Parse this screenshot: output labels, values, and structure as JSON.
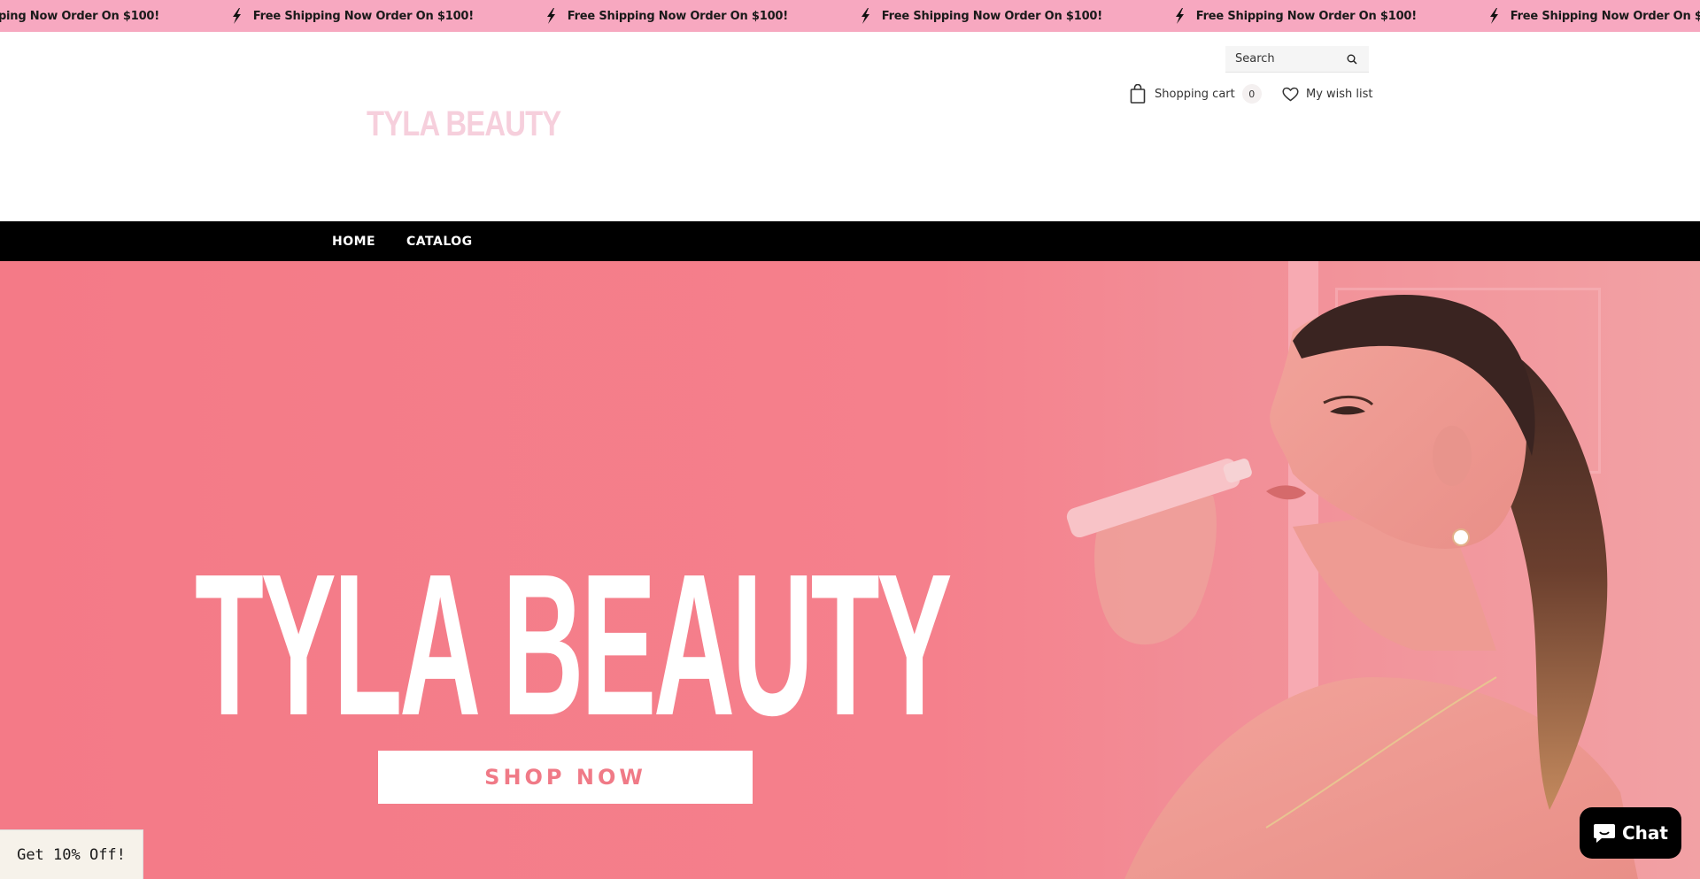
{
  "announcement": {
    "message": "Free Shipping Now Order On $100!",
    "partial_message": "ping Now Order On $100!",
    "icon": "lightning-bolt-icon",
    "background": "#f7a8c0"
  },
  "header": {
    "logo_text": "TYLA BEAUTY",
    "search": {
      "placeholder": "Search",
      "icon": "search-icon"
    },
    "cart": {
      "label": "Shopping cart",
      "count": "0",
      "icon": "shopping-bag-icon"
    },
    "wishlist": {
      "label": "My wish list",
      "icon": "heart-icon"
    }
  },
  "nav": {
    "items": [
      {
        "label": "HOME"
      },
      {
        "label": "CATALOG"
      }
    ]
  },
  "hero": {
    "title": "TYLA BEAUTY",
    "button_label": "SHOP NOW",
    "background": "#f47e8b"
  },
  "popups": {
    "discount_label": "Get 10% Off!",
    "chat_label": "Chat",
    "chat_icon": "chat-bubble-icon"
  }
}
